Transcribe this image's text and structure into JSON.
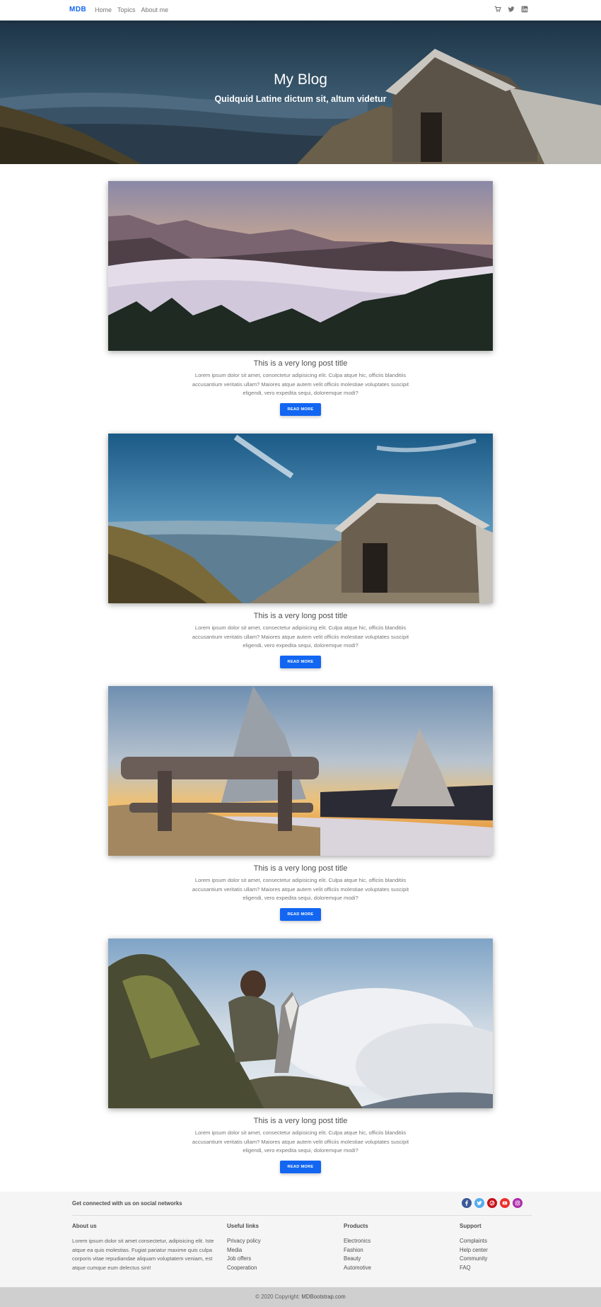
{
  "navbar": {
    "brand": "MDB",
    "links": [
      "Home",
      "Topics",
      "About me"
    ],
    "icons": [
      "shopping-cart-icon",
      "twitter-icon",
      "linkedin-icon"
    ]
  },
  "hero": {
    "title": "My Blog",
    "subtitle": "Quidquid Latine dictum sit, altum videtur"
  },
  "posts": [
    {
      "title": "This is a very long post title",
      "text": "Lorem ipsum dolor sit amet, consectetur adipisicing elit. Culpa atque hic, officiis blanditiis accusantium veritatis ullam? Maiores atque autem velit officiis molestiae voluptates suscipit eligendi, vero expedita sequi, doloremque modi?",
      "button": "READ MORE"
    },
    {
      "title": "This is a very long post title",
      "text": "Lorem ipsum dolor sit amet, consectetur adipisicing elit. Culpa atque hic, officiis blanditiis accusantium veritatis ullam? Maiores atque autem velit officiis molestiae voluptates suscipit eligendi, vero expedita sequi, doloremque modi?",
      "button": "READ MORE"
    },
    {
      "title": "This is a very long post title",
      "text": "Lorem ipsum dolor sit amet, consectetur adipisicing elit. Culpa atque hic, officiis blanditiis accusantium veritatis ullam? Maiores atque autem velit officiis molestiae voluptates suscipit eligendi, vero expedita sequi, doloremque modi?",
      "button": "READ MORE"
    },
    {
      "title": "This is a very long post title",
      "text": "Lorem ipsum dolor sit amet, consectetur adipisicing elit. Culpa atque hic, officiis blanditiis accusantium veritatis ullam? Maiores atque autem velit officiis molestiae voluptates suscipit eligendi, vero expedita sequi, doloremque modi?",
      "button": "READ MORE"
    }
  ],
  "footer": {
    "social_heading": "Get connected with us on social networks",
    "social_icons": [
      {
        "name": "facebook-icon",
        "color": "#3b5998"
      },
      {
        "name": "twitter-icon",
        "color": "#55acee"
      },
      {
        "name": "pinterest-icon",
        "color": "#c61118"
      },
      {
        "name": "youtube-icon",
        "color": "#ed302f"
      },
      {
        "name": "instagram-icon",
        "color": "#ac2bac"
      }
    ],
    "about": {
      "heading": "About us",
      "text": "Lorem ipsum dolor sit amet consectetur, adipisicing elit. Iste atque ea quis molestias. Fugiat pariatur maxime quis culpa corporis vitae repudiandae aliquam voluptatem veniam, est atque cumque eum delectus sint!"
    },
    "useful_links": {
      "heading": "Useful links",
      "items": [
        "Privacy policy",
        "Media",
        "Job offers",
        "Cooperation"
      ]
    },
    "products": {
      "heading": "Products",
      "items": [
        "Electronics",
        "Fashion",
        "Beauty",
        "Automotive"
      ]
    },
    "support": {
      "heading": "Support",
      "items": [
        "Complaints",
        "Help center",
        "Community",
        "FAQ"
      ]
    },
    "copyright_prefix": "© 2020 Copyright: ",
    "copyright_link": "MDBootstrap.com"
  },
  "colors": {
    "primary": "#1266f1",
    "footer_bg": "#f5f5f5",
    "copyright_bg": "#cfcfcf"
  }
}
